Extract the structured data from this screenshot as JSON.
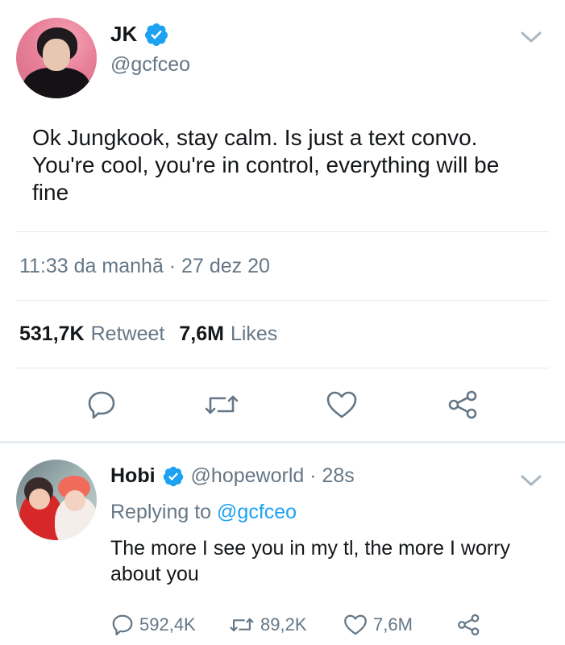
{
  "main_tweet": {
    "name": "JK",
    "handle": "@gcfceo",
    "text": "Ok Jungkook, stay calm. Is just a text convo. You're cool, you're in control, everything will be fine",
    "timestamp": "11:33 da manhã · 27 dez 20",
    "retweets_count": "531,7K",
    "retweets_label": "Retweet",
    "likes_count": "7,6M",
    "likes_label": "Likes"
  },
  "reply": {
    "name": "Hobi",
    "handle_time": "@hopeworld · 28s",
    "replying_prefix": "Replying to",
    "replying_handle": "@gcfceo",
    "text": "The more I see you in my tl, the more I worry about you",
    "reply_count": "592,4K",
    "retweet_count": "89,2K",
    "like_count": "7,6M"
  },
  "colors": {
    "verified": "#1da1f2",
    "link": "#1da1f2",
    "secondary_text": "#657786",
    "divider": "#e1e8ed"
  },
  "icons": [
    "verified-badge-icon",
    "chevron-down-icon",
    "reply-icon",
    "retweet-icon",
    "like-icon",
    "share-icon"
  ]
}
